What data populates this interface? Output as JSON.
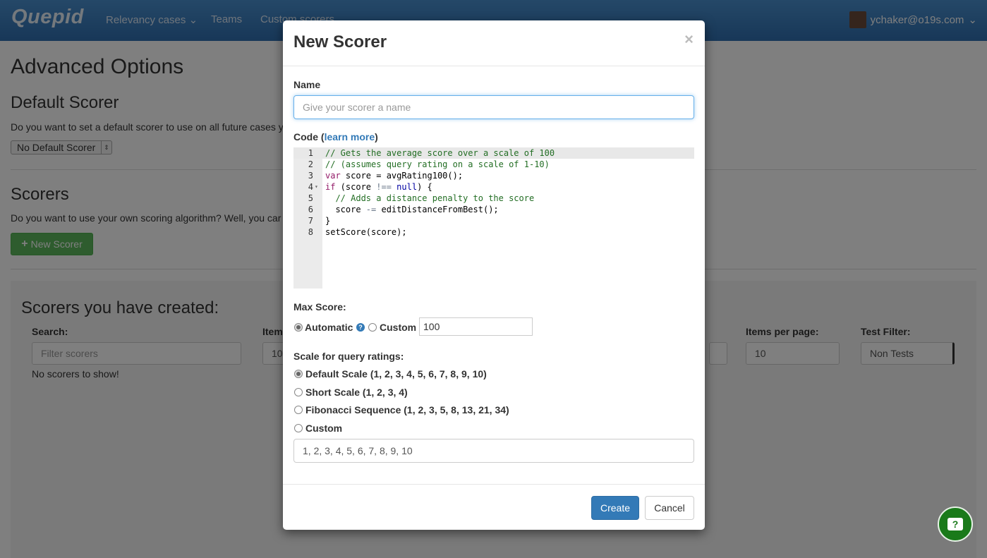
{
  "navbar": {
    "brand": "Quepid",
    "links": [
      "Relevancy cases",
      "Teams",
      "Custom scorers"
    ],
    "user": "ychaker@o19s.com"
  },
  "page": {
    "title": "Advanced Options",
    "default_scorer": {
      "heading": "Default Scorer",
      "text": "Do you want to set a default scorer to use on all future cases y",
      "select_value": "No Default Scorer"
    },
    "scorers": {
      "heading": "Scorers",
      "text": "Do you want to use your own scoring algorithm? Well, you car",
      "new_button": "New Scorer"
    },
    "created": {
      "heading": "Scorers you have created:",
      "search_label": "Search:",
      "search_placeholder": "Filter scorers",
      "items_label": "Item",
      "items_value": "10",
      "empty_text": "No scorers to show!",
      "per_page_label": "Items per page:",
      "per_page_value": "10",
      "test_filter_label": "Test Filter:",
      "test_filter_value": "Non Tests"
    }
  },
  "modal": {
    "title": "New Scorer",
    "close": "×",
    "name_label": "Name",
    "name_placeholder": "Give your scorer a name",
    "code_label_prefix": "Code (",
    "code_link": "learn more",
    "code_label_suffix": ")",
    "code_lines": [
      {
        "n": "1",
        "text": "// Gets the average score over a scale of 100"
      },
      {
        "n": "2",
        "text": "// (assumes query rating on a scale of 1-10)"
      },
      {
        "n": "3",
        "kw": "var",
        "text": " score = avgRating100();"
      },
      {
        "n": "4",
        "kw": "if",
        "pre": " (score ",
        "op": "!==",
        "mid": " ",
        "null": "null",
        "post": ") {"
      },
      {
        "n": "5",
        "text": "  // Adds a distance penalty to the score"
      },
      {
        "n": "6",
        "pre": "  score ",
        "op": "-=",
        "post": " editDistanceFromBest();"
      },
      {
        "n": "7",
        "text": "}"
      },
      {
        "n": "8",
        "text": "setScore(score);"
      }
    ],
    "max_score_label": "Max Score:",
    "automatic_label": "Automatic",
    "help_glyph": "?",
    "custom_label": "Custom",
    "max_score_value": "100",
    "scale_label": "Scale for query ratings:",
    "scale_options": [
      "Default Scale (1, 2, 3, 4, 5, 6, 7, 8, 9, 10)",
      "Short Scale (1, 2, 3, 4)",
      "Fibonacci Sequence (1, 2, 3, 5, 8, 13, 21, 34)",
      "Custom"
    ],
    "scale_selected": 0,
    "custom_scale_value": "1, 2, 3, 4, 5, 6, 7, 8, 9, 10",
    "create_button": "Create",
    "cancel_button": "Cancel"
  },
  "help_fab_glyph": "?",
  "colors": {
    "navbar": "#3a7dbf",
    "primary": "#337ab7",
    "success": "#5cb85c",
    "comment": "#236e24",
    "keyword": "#931a68"
  }
}
